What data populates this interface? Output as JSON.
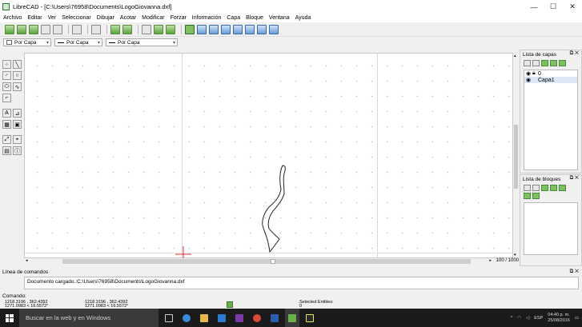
{
  "window": {
    "title": "LibreCAD - [C:\\Users\\76958\\Documents\\LogoGiovanna.dxf]",
    "controls": {
      "minimize": "—",
      "maximize": "☐",
      "close": "✕"
    }
  },
  "menu": [
    "Archivo",
    "Editar",
    "Ver",
    "Seleccionar",
    "Dibujar",
    "Acotar",
    "Modificar",
    "Forzar",
    "Información",
    "Capa",
    "Bloque",
    "Ventana",
    "Ayuda"
  ],
  "pen_toolbar": {
    "color": "Por Capa",
    "width": "Por Capa",
    "linetype": "Por Capa"
  },
  "layers_panel": {
    "title": "Lista de capas",
    "layers": [
      {
        "name": "0"
      },
      {
        "name": "Capa1"
      }
    ]
  },
  "blocks_panel": {
    "title": "Lista de bloques"
  },
  "canvas": {
    "zoom_label": "100 / 1000"
  },
  "command": {
    "header": "Línea de comandos",
    "output": "Documento cargado.:C:\\Users\\76958\\Documents\\LogoGiovanna.dxf",
    "prompt": "Comando:"
  },
  "status": {
    "coord_abs": "1218.3196 , 362.4392",
    "coord_abs2": "1271.0983 < 16.5572°",
    "coord_rel": "1218.3196 , 362.4392",
    "coord_rel2": "1271.0983 < 16.5572°",
    "selected_label": "Selected Entities:",
    "selected_count": "0"
  },
  "taskbar": {
    "search_placeholder": "Buscar en la web y en Windows",
    "lang": "ESP",
    "time": "04:40 p. m.",
    "date": "25/08/2016",
    "accent": "#1b1b1b"
  }
}
